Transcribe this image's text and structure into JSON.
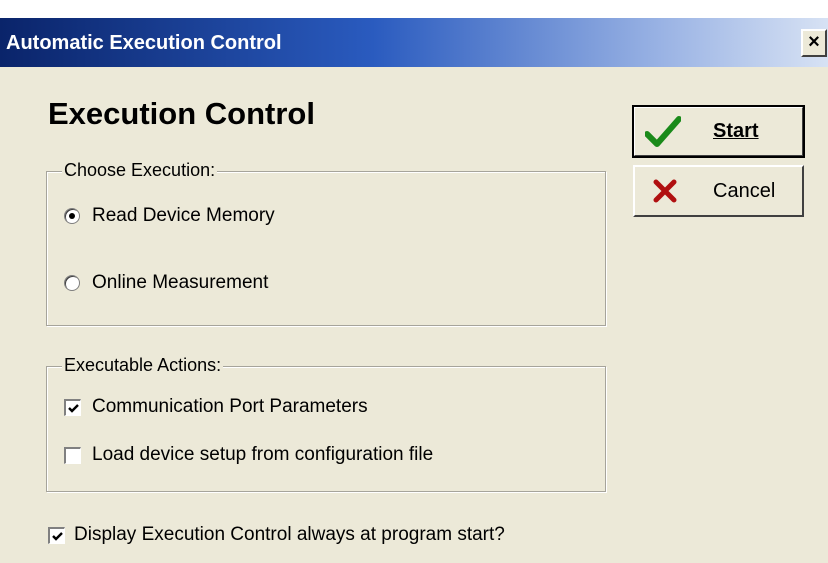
{
  "window": {
    "title": "Automatic Execution Control",
    "close_label": "×"
  },
  "heading": "Execution Control",
  "buttons": {
    "start": {
      "label": "Start",
      "icon": "checkmark-icon",
      "color": "#1a8a1a"
    },
    "cancel": {
      "label": "Cancel",
      "icon": "x-mark-icon",
      "color": "#b01010"
    }
  },
  "choose_execution": {
    "legend": "Choose Execution:",
    "options": [
      {
        "label": "Read Device Memory",
        "selected": true
      },
      {
        "label": "Online Measurement",
        "selected": false
      }
    ]
  },
  "executable_actions": {
    "legend": "Executable Actions:",
    "items": [
      {
        "label": "Communication Port Parameters",
        "checked": true
      },
      {
        "label": "Load device setup from configuration file",
        "checked": false
      }
    ]
  },
  "display_always": {
    "label": "Display Execution Control always at program start?",
    "checked": true
  }
}
